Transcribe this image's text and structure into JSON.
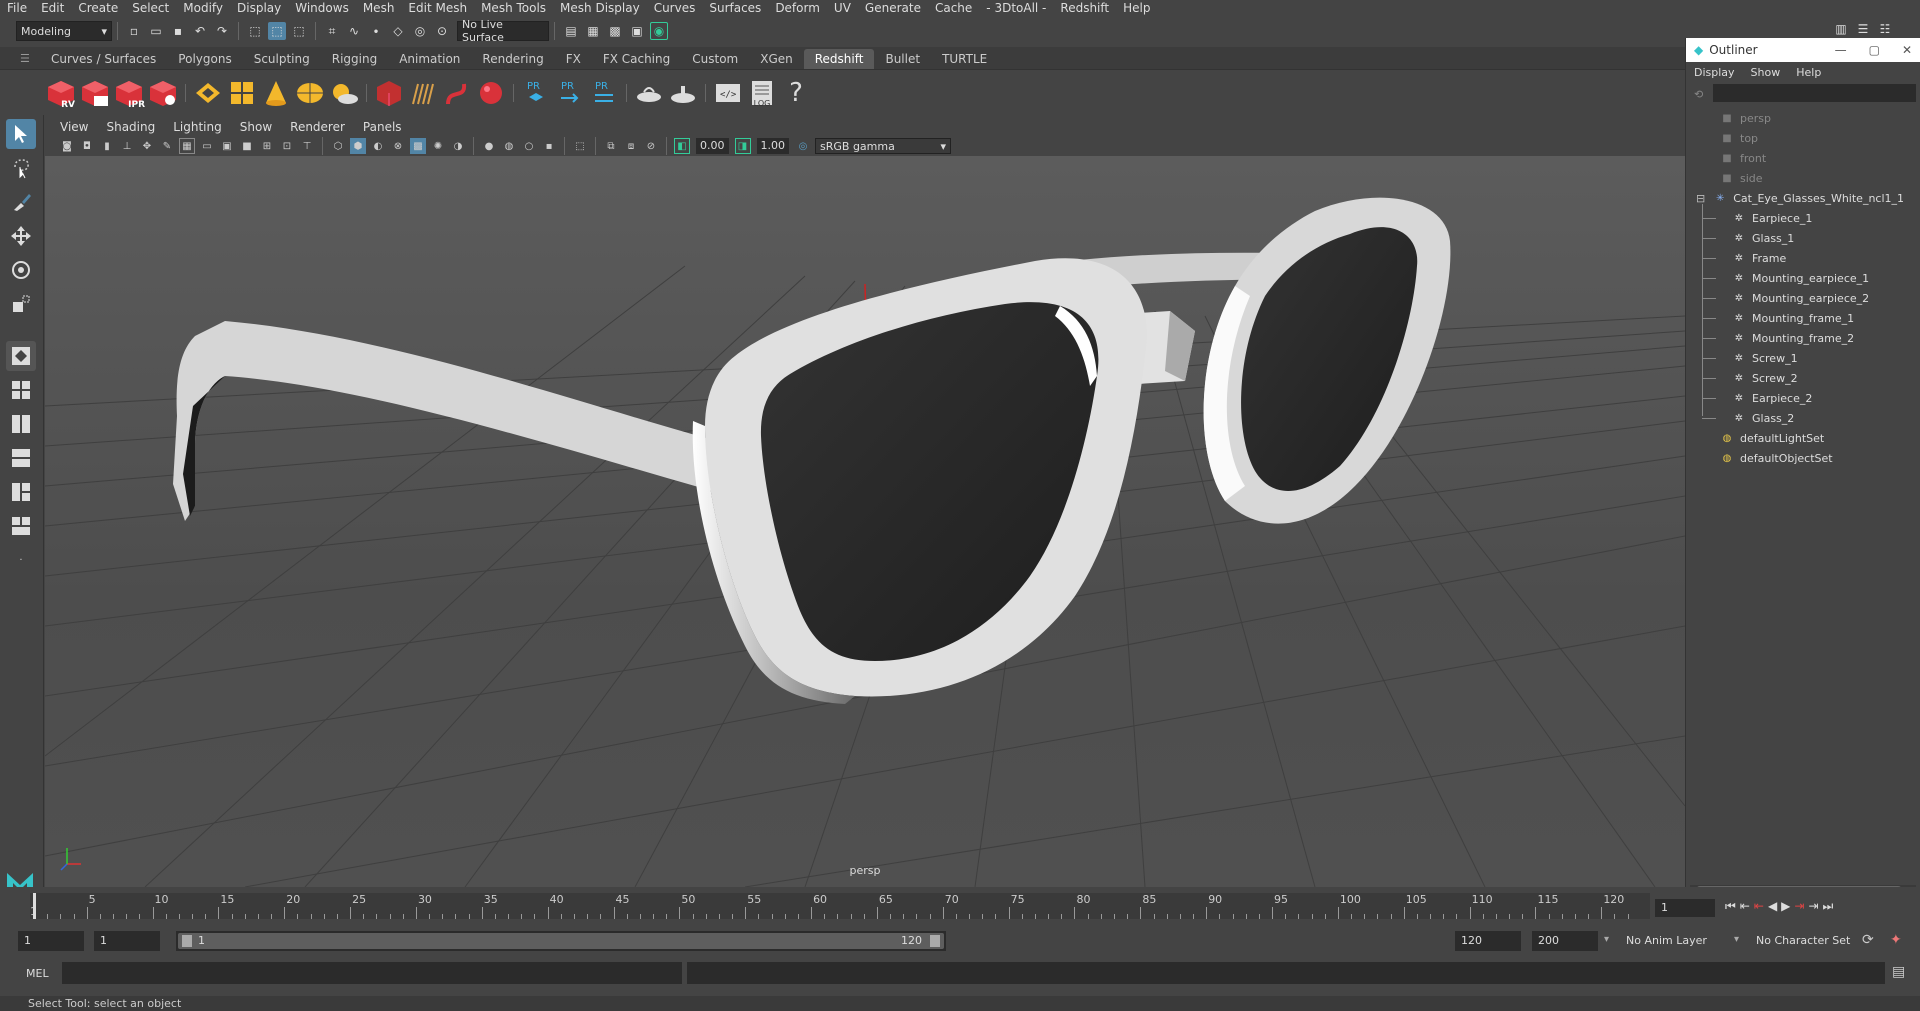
{
  "menu": [
    "File",
    "Edit",
    "Create",
    "Select",
    "Modify",
    "Display",
    "Windows",
    "Mesh",
    "Edit Mesh",
    "Mesh Tools",
    "Mesh Display",
    "Curves",
    "Surfaces",
    "Deform",
    "UV",
    "Generate",
    "Cache",
    "- 3DtoAll -",
    "Redshift",
    "Help"
  ],
  "status": {
    "mode": "Modeling",
    "live_surface": "No Live Surface"
  },
  "shelf_tabs": [
    "Curves / Surfaces",
    "Polygons",
    "Sculpting",
    "Rigging",
    "Animation",
    "Rendering",
    "FX",
    "FX Caching",
    "Custom",
    "XGen",
    "Redshift",
    "Bullet",
    "TURTLE"
  ],
  "shelf_active": "Redshift",
  "shelf_labels": {
    "rv": "RV",
    "ipr": "IPR",
    "pr": "PR",
    "log": "LOG"
  },
  "panel_menu": [
    "View",
    "Shading",
    "Lighting",
    "Show",
    "Renderer",
    "Panels"
  ],
  "panel_toolbar": {
    "exposure": "0.00",
    "gamma": "1.00",
    "colorspace": "sRGB gamma"
  },
  "viewport": {
    "camera_label": "persp"
  },
  "outliner": {
    "title": "Outliner",
    "menu": [
      "Display",
      "Show",
      "Help"
    ],
    "cameras": [
      "persp",
      "top",
      "front",
      "side"
    ],
    "group": "Cat_Eye_Glasses_White_ncl1_1",
    "children": [
      "Earpiece_1",
      "Glass_1",
      "Frame",
      "Mounting_earpiece_1",
      "Mounting_earpiece_2",
      "Mounting_frame_1",
      "Mounting_frame_2",
      "Screw_1",
      "Screw_2",
      "Earpiece_2",
      "Glass_2"
    ],
    "sets": [
      "defaultLightSet",
      "defaultObjectSet"
    ]
  },
  "timeline": {
    "ticks": [
      "5",
      "10",
      "15",
      "20",
      "25",
      "30",
      "35",
      "40",
      "45",
      "50",
      "55",
      "60",
      "65",
      "70",
      "75",
      "80",
      "85",
      "90",
      "95",
      "100",
      "105",
      "110",
      "115",
      "120"
    ],
    "start_marker": "1",
    "current_frame": "1"
  },
  "range": {
    "start": "1",
    "playback_start": "1",
    "slider_start": "1",
    "slider_end": "120",
    "playback_end": "120",
    "end": "200",
    "anim_layer": "No Anim Layer",
    "char_set": "No Character Set"
  },
  "cmd": {
    "label": "MEL"
  },
  "help_line": "Select Tool: select an object",
  "colors": {
    "accent": "#5285a6",
    "redshift": "#d9323a",
    "bg": "#444444"
  }
}
